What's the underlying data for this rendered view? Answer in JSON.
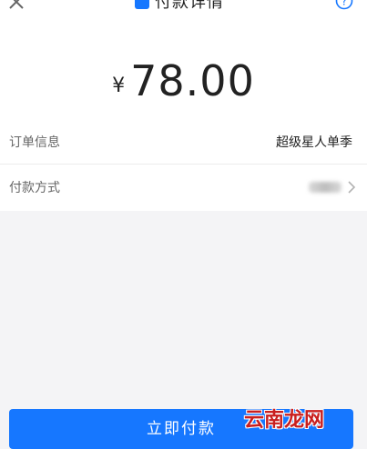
{
  "header": {
    "title": "付款详情",
    "close_icon": "close-icon",
    "help_icon": "help-icon"
  },
  "payment": {
    "currency_symbol": "¥",
    "amount": "78.00"
  },
  "details": {
    "order_label": "订单信息",
    "order_value": "超级星人单季",
    "method_label": "付款方式"
  },
  "actions": {
    "pay_label": "立即付款"
  },
  "watermark": {
    "text": "云南龙网"
  },
  "colors": {
    "accent": "#1677ff",
    "background": "#f4f4f6"
  }
}
